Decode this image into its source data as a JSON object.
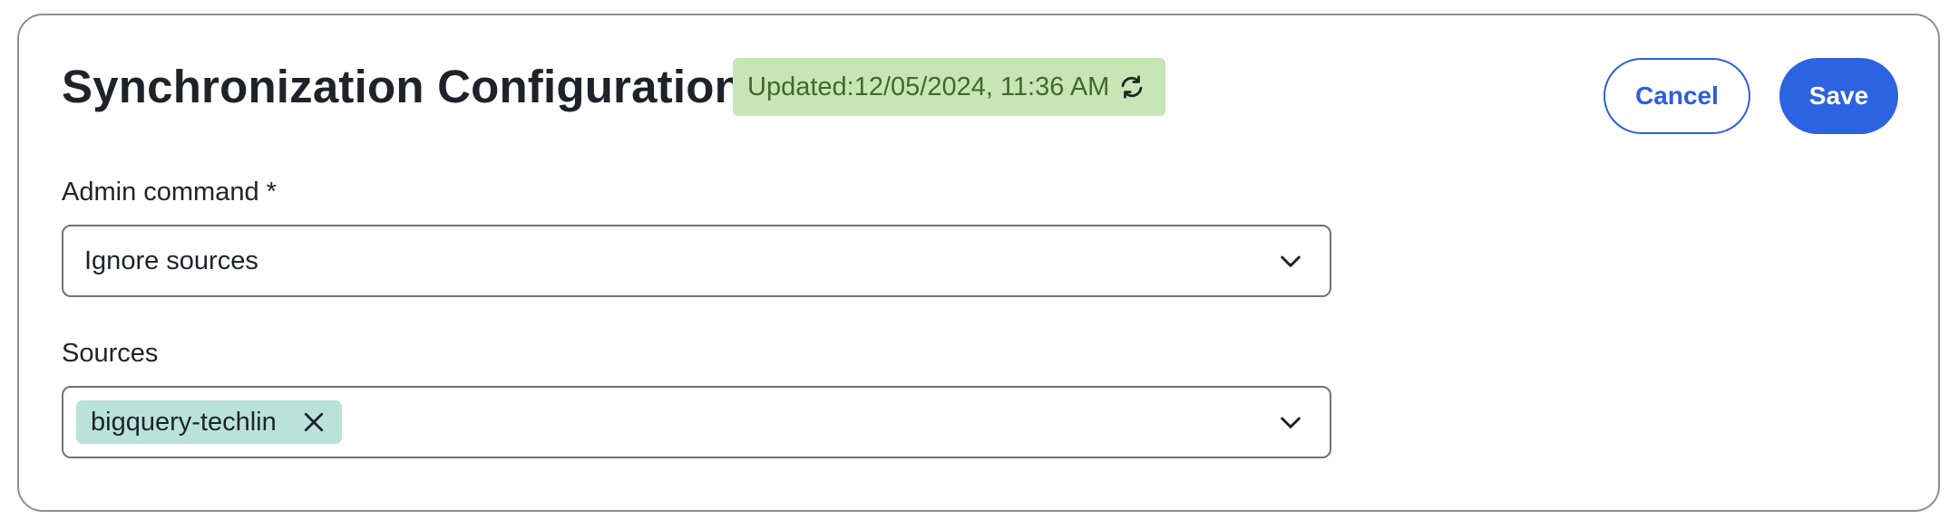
{
  "header": {
    "title": "Synchronization Configuration",
    "updated_badge": {
      "label": "Updated:12/05/2024, 11:36 AM",
      "icon": "sync-icon",
      "color": "#c8e6b5"
    },
    "actions": {
      "cancel_label": "Cancel",
      "save_label": "Save",
      "accent_color": "#2c63e0"
    }
  },
  "form": {
    "admin_command": {
      "label": "Admin command *",
      "value": "Ignore sources",
      "icon": "chevron-down-icon"
    },
    "sources": {
      "label": "Sources",
      "selected": [
        {
          "label": "bigquery-techlin",
          "icon": "close-icon"
        }
      ],
      "icon": "chevron-down-icon"
    }
  }
}
